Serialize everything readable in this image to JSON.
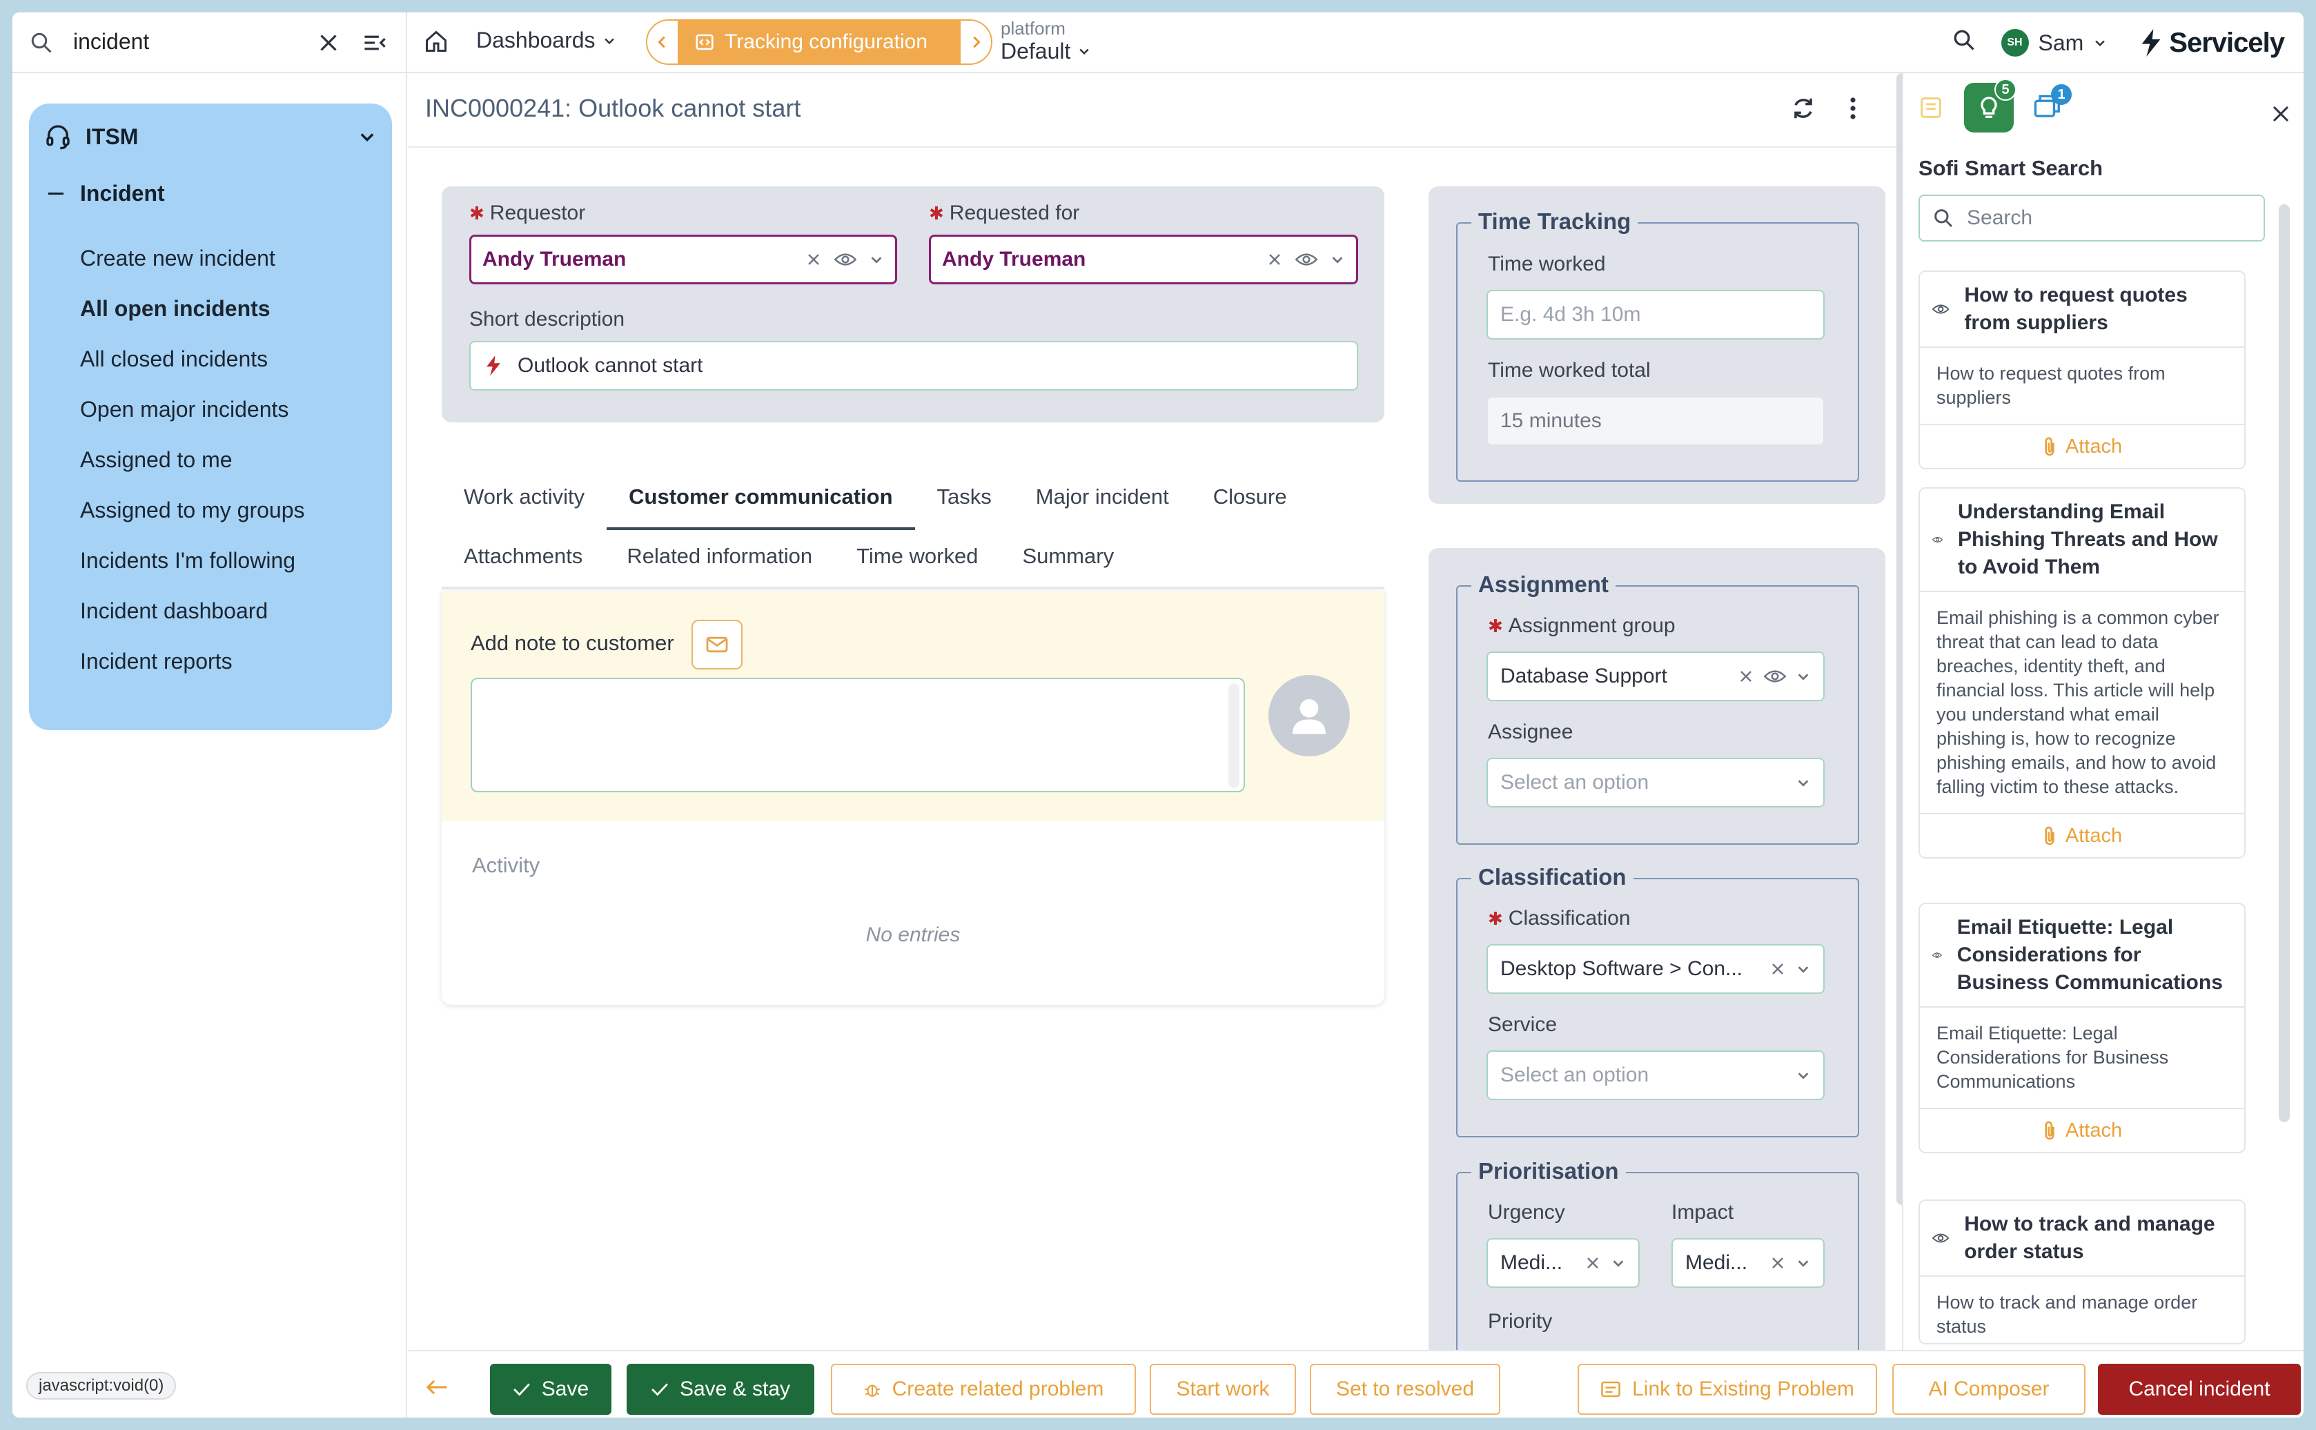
{
  "search": {
    "query": "incident"
  },
  "topnav": {
    "dashboards_label": "Dashboards",
    "tracking_label": "Tracking configuration",
    "platform_label": "platform",
    "platform_value": "Default",
    "user_initials": "SH",
    "user_name": "Sam",
    "brand": "Servicely"
  },
  "sidebar": {
    "module": "ITSM",
    "section": "Incident",
    "items": [
      {
        "label": "Create new incident"
      },
      {
        "label": "All open incidents"
      },
      {
        "label": "All closed incidents"
      },
      {
        "label": "Open major incidents"
      },
      {
        "label": "Assigned to me"
      },
      {
        "label": "Assigned to my groups"
      },
      {
        "label": "Incidents I'm following"
      },
      {
        "label": "Incident dashboard"
      },
      {
        "label": "Incident reports"
      }
    ],
    "active_index": 1
  },
  "status_url": "javascript:void(0)",
  "record": {
    "title": "INC0000241: Outlook cannot start",
    "requestor_label": "Requestor",
    "requestor_value": "Andy Trueman",
    "requested_for_label": "Requested for",
    "requested_for_value": "Andy Trueman",
    "short_desc_label": "Short description",
    "short_desc_value": "Outlook cannot start"
  },
  "tabs": {
    "row1": [
      "Work activity",
      "Customer communication",
      "Tasks",
      "Major incident",
      "Closure"
    ],
    "row2": [
      "Attachments",
      "Related information",
      "Time worked",
      "Summary"
    ],
    "active": "Customer communication"
  },
  "customer_comm": {
    "add_note_label": "Add note to customer",
    "activity_label": "Activity",
    "empty_text": "No entries"
  },
  "time_tracking": {
    "legend": "Time Tracking",
    "worked_label": "Time worked",
    "worked_placeholder": "E.g. 4d 3h 10m",
    "total_label": "Time worked total",
    "total_value": "15 minutes"
  },
  "assignment": {
    "legend": "Assignment",
    "group_label": "Assignment group",
    "group_value": "Database Support",
    "assignee_label": "Assignee",
    "assignee_placeholder": "Select an option"
  },
  "classification": {
    "legend": "Classification",
    "class_label": "Classification",
    "class_value": "Desktop Software > Con...",
    "service_label": "Service",
    "service_placeholder": "Select an option"
  },
  "prioritisation": {
    "legend": "Prioritisation",
    "urgency_label": "Urgency",
    "urgency_value": "Medi...",
    "impact_label": "Impact",
    "impact_value": "Medi...",
    "priority_label": "Priority"
  },
  "right_panel": {
    "badge_kb": "5",
    "badge_other": "1",
    "title": "Sofi Smart Search",
    "search_placeholder": "Search",
    "attach_label": "Attach",
    "articles": [
      {
        "title": "How to request quotes from suppliers",
        "body": "How to request quotes from suppliers"
      },
      {
        "title": "Understanding Email Phishing Threats and How to Avoid Them",
        "body": "Email phishing is a common cyber threat that can lead to data breaches, identity theft, and financial loss. This article will help you understand what email phishing is, how to recognize phishing emails, and how to avoid falling victim to these attacks."
      },
      {
        "title": "Email Etiquette: Legal Considerations for Business Communications",
        "body": "Email Etiquette: Legal Considerations for Business Communications"
      },
      {
        "title": "How to track and manage order status",
        "body": "How to track and manage order status"
      }
    ]
  },
  "actions": {
    "save": "Save",
    "save_stay": "Save & stay",
    "create_problem": "Create related problem",
    "start_work": "Start work",
    "set_resolved": "Set to resolved",
    "link_problem": "Link to Existing Problem",
    "ai_composer": "AI Composer",
    "cancel_incident": "Cancel incident"
  },
  "colors": {
    "sidebar_card": "#a6d2f6",
    "accent_orange": "#f0a94d",
    "requestor_purple": "#6d1561",
    "primary_green": "#1d6b3a",
    "danger_red": "#a31f1f"
  }
}
